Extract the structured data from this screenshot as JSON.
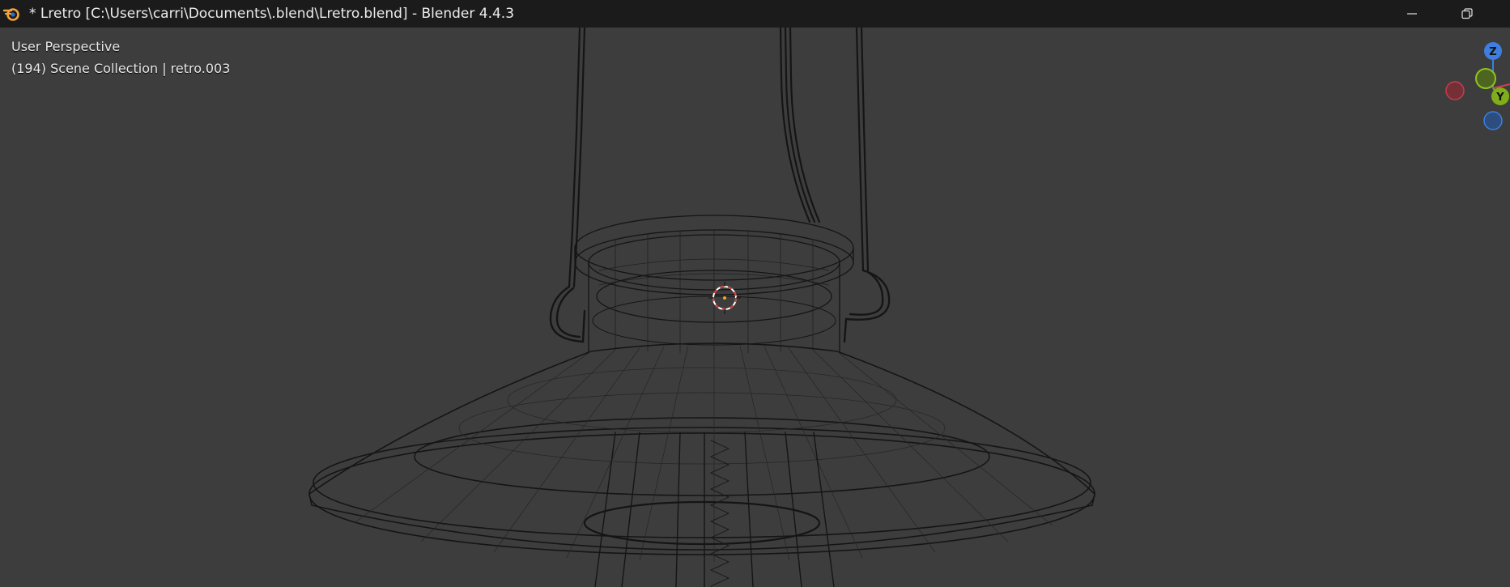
{
  "window": {
    "title": "* Lretro [C:\\Users\\carri\\Documents\\.blend\\Lretro.blend] - Blender 4.4.3",
    "icons": [
      "blender-logo",
      "minimize-icon",
      "restore-icon"
    ]
  },
  "viewport": {
    "view_label": "User Perspective",
    "collection_label": "(194) Scene Collection | retro.003",
    "shading": "wireframe",
    "background_color": "#3d3d3d"
  },
  "gizmo": {
    "z_label": "Z",
    "y_label": "Y",
    "colors": {
      "z": "#3d7ee0",
      "y": "#7fae1a",
      "x": "#d43e4d"
    }
  }
}
